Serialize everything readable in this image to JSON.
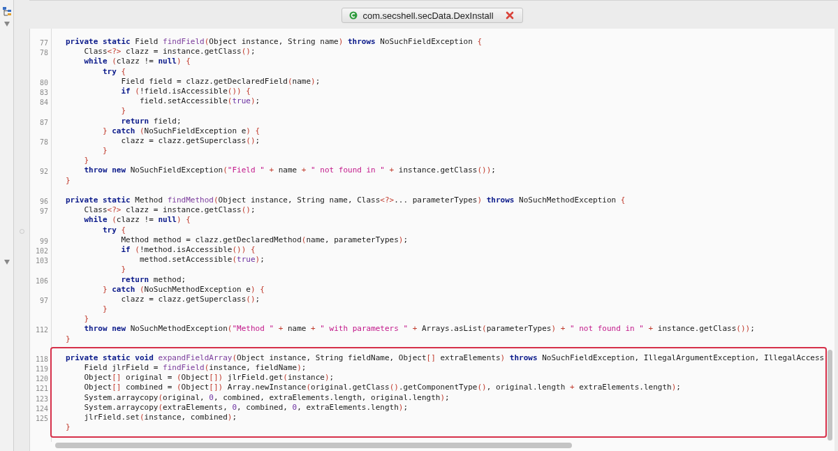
{
  "tab": {
    "title": "com.secshell.secData.DexInstall"
  },
  "blocks": [
    {
      "highlighted": false,
      "lines": [
        {
          "number": "77",
          "tokens": [
            {
              "kind": "keyword",
              "text": "private static"
            },
            {
              "kind": "plain",
              "text": " Field "
            },
            {
              "kind": "method",
              "text": "findField"
            },
            {
              "kind": "punct",
              "text": "("
            },
            {
              "kind": "plain",
              "text": "Object instance, String name"
            },
            {
              "kind": "punct",
              "text": ")"
            },
            {
              "kind": "keyword",
              "text": " throws"
            },
            {
              "kind": "plain",
              "text": " NoSuchFieldException "
            },
            {
              "kind": "punct",
              "text": "{"
            }
          ]
        },
        {
          "number": "78",
          "tokens": [
            {
              "kind": "plain",
              "text": "    Class"
            },
            {
              "kind": "punct",
              "text": "<?>"
            },
            {
              "kind": "plain",
              "text": " clazz = instance.getClass"
            },
            {
              "kind": "punct",
              "text": "()"
            },
            {
              "kind": "plain",
              "text": ";"
            }
          ]
        },
        {
          "tokens": [
            {
              "kind": "keyword",
              "text": "    while"
            },
            {
              "kind": "punct",
              "text": " ("
            },
            {
              "kind": "plain",
              "text": "clazz != "
            },
            {
              "kind": "keyword",
              "text": "null"
            },
            {
              "kind": "punct",
              "text": ")"
            },
            {
              "kind": "punct",
              "text": " {"
            }
          ]
        },
        {
          "tokens": [
            {
              "kind": "keyword",
              "text": "        try"
            },
            {
              "kind": "punct",
              "text": " {"
            }
          ]
        },
        {
          "number": "80",
          "tokens": [
            {
              "kind": "plain",
              "text": "            Field field = clazz.getDeclaredField"
            },
            {
              "kind": "punct",
              "text": "("
            },
            {
              "kind": "plain",
              "text": "name"
            },
            {
              "kind": "punct",
              "text": ")"
            },
            {
              "kind": "plain",
              "text": ";"
            }
          ]
        },
        {
          "number": "83",
          "tokens": [
            {
              "kind": "keyword",
              "text": "            if"
            },
            {
              "kind": "punct",
              "text": " ("
            },
            {
              "kind": "plain",
              "text": "!field.isAccessible"
            },
            {
              "kind": "punct",
              "text": "())"
            },
            {
              "kind": "punct",
              "text": " {"
            }
          ]
        },
        {
          "number": "84",
          "tokens": [
            {
              "kind": "plain",
              "text": "                field.setAccessible"
            },
            {
              "kind": "punct",
              "text": "("
            },
            {
              "kind": "literal",
              "text": "true"
            },
            {
              "kind": "punct",
              "text": ")"
            },
            {
              "kind": "plain",
              "text": ";"
            }
          ]
        },
        {
          "tokens": [
            {
              "kind": "punct",
              "text": "            }"
            }
          ]
        },
        {
          "number": "87",
          "tokens": [
            {
              "kind": "keyword",
              "text": "            return"
            },
            {
              "kind": "plain",
              "text": " field;"
            }
          ]
        },
        {
          "tokens": [
            {
              "kind": "punct",
              "text": "        }"
            },
            {
              "kind": "keyword",
              "text": " catch"
            },
            {
              "kind": "punct",
              "text": " ("
            },
            {
              "kind": "plain",
              "text": "NoSuchFieldException e"
            },
            {
              "kind": "punct",
              "text": ")"
            },
            {
              "kind": "punct",
              "text": " {"
            }
          ]
        },
        {
          "number": "78",
          "tokens": [
            {
              "kind": "plain",
              "text": "            clazz = clazz.getSuperclass"
            },
            {
              "kind": "punct",
              "text": "()"
            },
            {
              "kind": "plain",
              "text": ";"
            }
          ]
        },
        {
          "tokens": [
            {
              "kind": "punct",
              "text": "        }"
            }
          ]
        },
        {
          "tokens": [
            {
              "kind": "punct",
              "text": "    }"
            }
          ]
        },
        {
          "number": "92",
          "tokens": [
            {
              "kind": "keyword",
              "text": "    throw new"
            },
            {
              "kind": "plain",
              "text": " NoSuchFieldException"
            },
            {
              "kind": "punct",
              "text": "("
            },
            {
              "kind": "string",
              "text": "\"Field \""
            },
            {
              "kind": "punct",
              "text": " +"
            },
            {
              "kind": "plain",
              "text": " name "
            },
            {
              "kind": "punct",
              "text": "+"
            },
            {
              "kind": "string",
              "text": " \" not found in \""
            },
            {
              "kind": "punct",
              "text": " +"
            },
            {
              "kind": "plain",
              "text": " instance.getClass"
            },
            {
              "kind": "punct",
              "text": "())"
            },
            {
              "kind": "plain",
              "text": ";"
            }
          ]
        },
        {
          "tokens": [
            {
              "kind": "punct",
              "text": "}"
            }
          ]
        }
      ]
    },
    {
      "highlighted": false,
      "lines": [
        {
          "number": "96",
          "tokens": [
            {
              "kind": "keyword",
              "text": "private static"
            },
            {
              "kind": "plain",
              "text": " Method "
            },
            {
              "kind": "method",
              "text": "findMethod"
            },
            {
              "kind": "punct",
              "text": "("
            },
            {
              "kind": "plain",
              "text": "Object instance, String name, Class"
            },
            {
              "kind": "punct",
              "text": "<?>"
            },
            {
              "kind": "plain",
              "text": "... parameterTypes"
            },
            {
              "kind": "punct",
              "text": ")"
            },
            {
              "kind": "keyword",
              "text": " throws"
            },
            {
              "kind": "plain",
              "text": " NoSuchMethodException "
            },
            {
              "kind": "punct",
              "text": "{"
            }
          ]
        },
        {
          "number": "97",
          "tokens": [
            {
              "kind": "plain",
              "text": "    Class"
            },
            {
              "kind": "punct",
              "text": "<?>"
            },
            {
              "kind": "plain",
              "text": " clazz = instance.getClass"
            },
            {
              "kind": "punct",
              "text": "()"
            },
            {
              "kind": "plain",
              "text": ";"
            }
          ]
        },
        {
          "tokens": [
            {
              "kind": "keyword",
              "text": "    while"
            },
            {
              "kind": "punct",
              "text": " ("
            },
            {
              "kind": "plain",
              "text": "clazz != "
            },
            {
              "kind": "keyword",
              "text": "null"
            },
            {
              "kind": "punct",
              "text": ")"
            },
            {
              "kind": "punct",
              "text": " {"
            }
          ]
        },
        {
          "tokens": [
            {
              "kind": "keyword",
              "text": "        try"
            },
            {
              "kind": "punct",
              "text": " {"
            }
          ]
        },
        {
          "number": "99",
          "tokens": [
            {
              "kind": "plain",
              "text": "            Method method = clazz.getDeclaredMethod"
            },
            {
              "kind": "punct",
              "text": "("
            },
            {
              "kind": "plain",
              "text": "name, parameterTypes"
            },
            {
              "kind": "punct",
              "text": ")"
            },
            {
              "kind": "plain",
              "text": ";"
            }
          ]
        },
        {
          "number": "102",
          "tokens": [
            {
              "kind": "keyword",
              "text": "            if"
            },
            {
              "kind": "punct",
              "text": " ("
            },
            {
              "kind": "plain",
              "text": "!method.isAccessible"
            },
            {
              "kind": "punct",
              "text": "())"
            },
            {
              "kind": "punct",
              "text": " {"
            }
          ]
        },
        {
          "number": "103",
          "tokens": [
            {
              "kind": "plain",
              "text": "                method.setAccessible"
            },
            {
              "kind": "punct",
              "text": "("
            },
            {
              "kind": "literal",
              "text": "true"
            },
            {
              "kind": "punct",
              "text": ")"
            },
            {
              "kind": "plain",
              "text": ";"
            }
          ]
        },
        {
          "tokens": [
            {
              "kind": "punct",
              "text": "            }"
            }
          ]
        },
        {
          "number": "106",
          "tokens": [
            {
              "kind": "keyword",
              "text": "            return"
            },
            {
              "kind": "plain",
              "text": " method;"
            }
          ]
        },
        {
          "tokens": [
            {
              "kind": "punct",
              "text": "        }"
            },
            {
              "kind": "keyword",
              "text": " catch"
            },
            {
              "kind": "punct",
              "text": " ("
            },
            {
              "kind": "plain",
              "text": "NoSuchMethodException e"
            },
            {
              "kind": "punct",
              "text": ")"
            },
            {
              "kind": "punct",
              "text": " {"
            }
          ]
        },
        {
          "number": "97",
          "tokens": [
            {
              "kind": "plain",
              "text": "            clazz = clazz.getSuperclass"
            },
            {
              "kind": "punct",
              "text": "()"
            },
            {
              "kind": "plain",
              "text": ";"
            }
          ]
        },
        {
          "tokens": [
            {
              "kind": "punct",
              "text": "        }"
            }
          ]
        },
        {
          "tokens": [
            {
              "kind": "punct",
              "text": "    }"
            }
          ]
        },
        {
          "number": "112",
          "tokens": [
            {
              "kind": "keyword",
              "text": "    throw new"
            },
            {
              "kind": "plain",
              "text": " NoSuchMethodException"
            },
            {
              "kind": "punct",
              "text": "("
            },
            {
              "kind": "string",
              "text": "\"Method \""
            },
            {
              "kind": "punct",
              "text": " +"
            },
            {
              "kind": "plain",
              "text": " name "
            },
            {
              "kind": "punct",
              "text": "+"
            },
            {
              "kind": "string",
              "text": " \" with parameters \""
            },
            {
              "kind": "punct",
              "text": " +"
            },
            {
              "kind": "plain",
              "text": " Arrays.asList"
            },
            {
              "kind": "punct",
              "text": "("
            },
            {
              "kind": "plain",
              "text": "parameterTypes"
            },
            {
              "kind": "punct",
              "text": ")"
            },
            {
              "kind": "punct",
              "text": " +"
            },
            {
              "kind": "string",
              "text": " \" not found in \""
            },
            {
              "kind": "punct",
              "text": " +"
            },
            {
              "kind": "plain",
              "text": " instance.getClass"
            },
            {
              "kind": "punct",
              "text": "())"
            },
            {
              "kind": "plain",
              "text": ";"
            }
          ]
        },
        {
          "tokens": [
            {
              "kind": "punct",
              "text": "}"
            }
          ]
        }
      ]
    },
    {
      "highlighted": true,
      "lines": [
        {
          "number": "118",
          "tokens": [
            {
              "kind": "keyword",
              "text": "private static void"
            },
            {
              "kind": "method",
              "text": " expandFieldArray"
            },
            {
              "kind": "punct",
              "text": "("
            },
            {
              "kind": "plain",
              "text": "Object instance, String fieldName, Object"
            },
            {
              "kind": "punct",
              "text": "[]"
            },
            {
              "kind": "plain",
              "text": " extraElements"
            },
            {
              "kind": "punct",
              "text": ")"
            },
            {
              "kind": "keyword",
              "text": " throws"
            },
            {
              "kind": "plain",
              "text": " NoSuchFieldException, IllegalArgumentException, IllegalAccess"
            }
          ]
        },
        {
          "number": "119",
          "tokens": [
            {
              "kind": "plain",
              "text": "    Field jlrField = "
            },
            {
              "kind": "method",
              "text": "findField"
            },
            {
              "kind": "punct",
              "text": "("
            },
            {
              "kind": "plain",
              "text": "instance, fieldName"
            },
            {
              "kind": "punct",
              "text": ")"
            },
            {
              "kind": "plain",
              "text": ";"
            }
          ]
        },
        {
          "number": "120",
          "tokens": [
            {
              "kind": "plain",
              "text": "    Object"
            },
            {
              "kind": "punct",
              "text": "[]"
            },
            {
              "kind": "plain",
              "text": " original = "
            },
            {
              "kind": "punct",
              "text": "("
            },
            {
              "kind": "plain",
              "text": "Object"
            },
            {
              "kind": "punct",
              "text": "[])"
            },
            {
              "kind": "plain",
              "text": " jlrField.get"
            },
            {
              "kind": "punct",
              "text": "("
            },
            {
              "kind": "plain",
              "text": "instance"
            },
            {
              "kind": "punct",
              "text": ")"
            },
            {
              "kind": "plain",
              "text": ";"
            }
          ]
        },
        {
          "number": "121",
          "tokens": [
            {
              "kind": "plain",
              "text": "    Object"
            },
            {
              "kind": "punct",
              "text": "[]"
            },
            {
              "kind": "plain",
              "text": " combined = "
            },
            {
              "kind": "punct",
              "text": "("
            },
            {
              "kind": "plain",
              "text": "Object"
            },
            {
              "kind": "punct",
              "text": "[])"
            },
            {
              "kind": "plain",
              "text": " Array.newInstance"
            },
            {
              "kind": "punct",
              "text": "("
            },
            {
              "kind": "plain",
              "text": "original.getClass"
            },
            {
              "kind": "punct",
              "text": "()"
            },
            {
              "kind": "plain",
              "text": ".getComponentType"
            },
            {
              "kind": "punct",
              "text": "()"
            },
            {
              "kind": "plain",
              "text": ", original.length "
            },
            {
              "kind": "punct",
              "text": "+"
            },
            {
              "kind": "plain",
              "text": " extraElements.length"
            },
            {
              "kind": "punct",
              "text": ")"
            },
            {
              "kind": "plain",
              "text": ";"
            }
          ]
        },
        {
          "number": "123",
          "tokens": [
            {
              "kind": "plain",
              "text": "    System.arraycopy"
            },
            {
              "kind": "punct",
              "text": "("
            },
            {
              "kind": "plain",
              "text": "original, "
            },
            {
              "kind": "literal",
              "text": "0"
            },
            {
              "kind": "plain",
              "text": ", combined, extraElements.length, original.length"
            },
            {
              "kind": "punct",
              "text": ")"
            },
            {
              "kind": "plain",
              "text": ";"
            }
          ]
        },
        {
          "number": "124",
          "tokens": [
            {
              "kind": "plain",
              "text": "    System.arraycopy"
            },
            {
              "kind": "punct",
              "text": "("
            },
            {
              "kind": "plain",
              "text": "extraElements, "
            },
            {
              "kind": "literal",
              "text": "0"
            },
            {
              "kind": "plain",
              "text": ", combined, "
            },
            {
              "kind": "literal",
              "text": "0"
            },
            {
              "kind": "plain",
              "text": ", extraElements.length"
            },
            {
              "kind": "punct",
              "text": ")"
            },
            {
              "kind": "plain",
              "text": ";"
            }
          ]
        },
        {
          "number": "125",
          "tokens": [
            {
              "kind": "plain",
              "text": "    jlrField.set"
            },
            {
              "kind": "punct",
              "text": "("
            },
            {
              "kind": "plain",
              "text": "instance, combined"
            },
            {
              "kind": "punct",
              "text": ")"
            },
            {
              "kind": "plain",
              "text": ";"
            }
          ]
        },
        {
          "tokens": [
            {
              "kind": "punct",
              "text": "}"
            }
          ]
        }
      ]
    }
  ]
}
